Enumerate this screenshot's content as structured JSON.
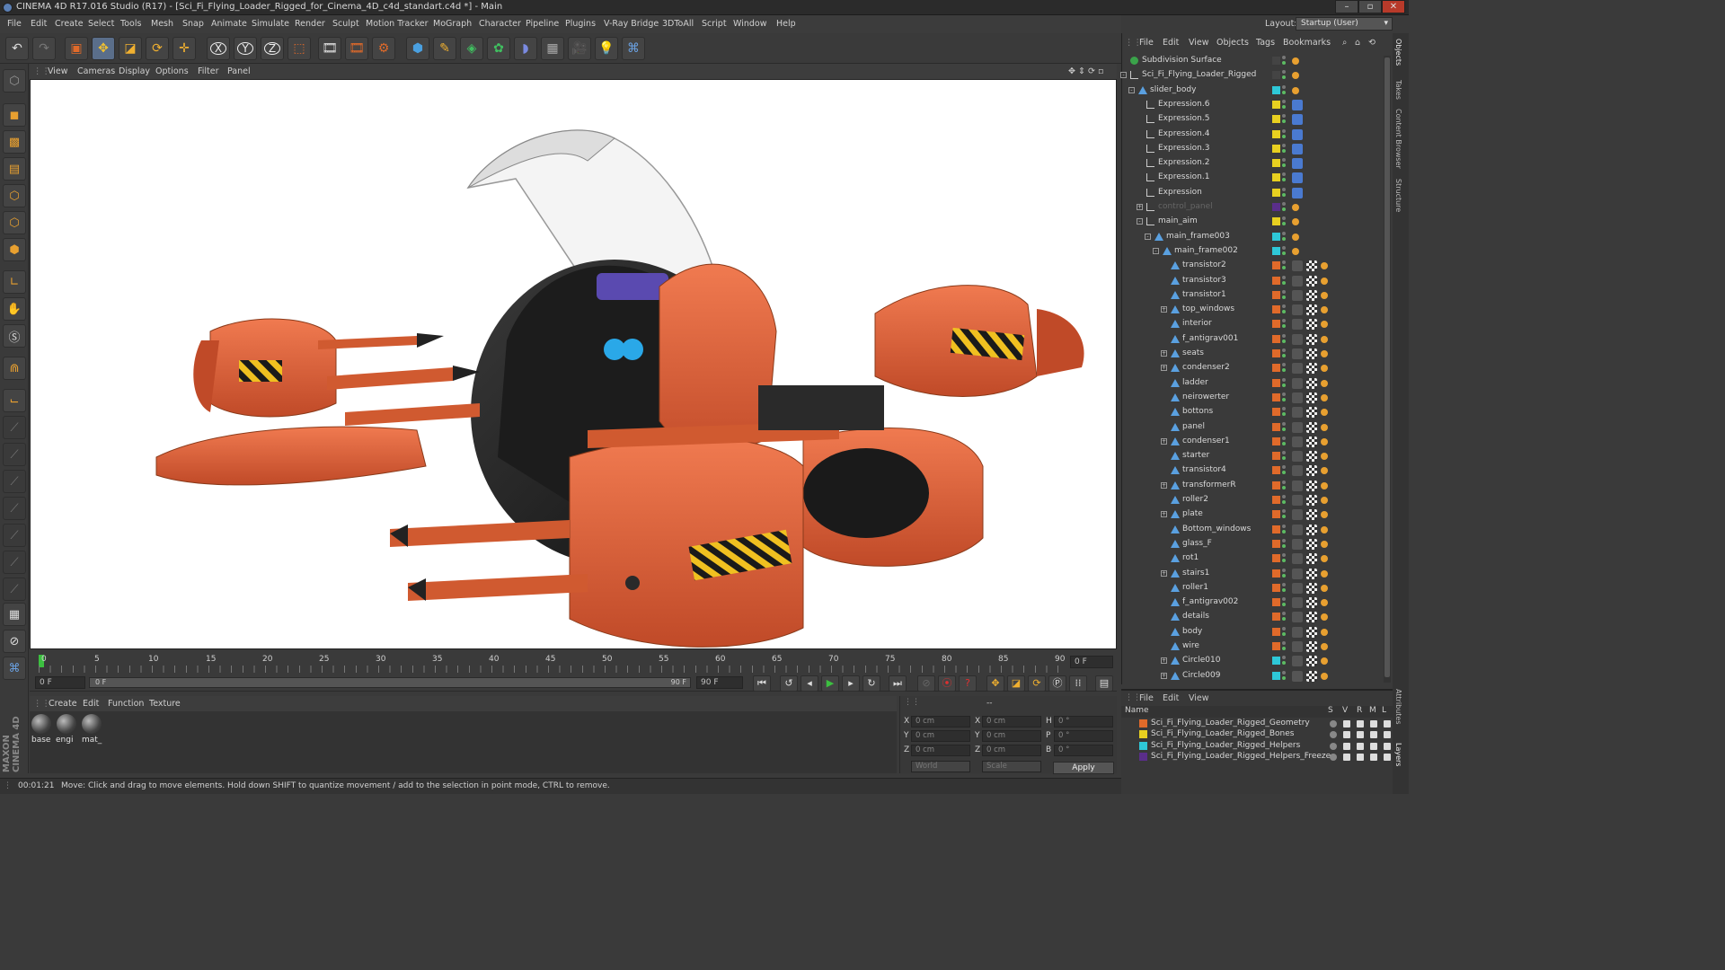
{
  "window": {
    "title": "CINEMA 4D R17.016 Studio (R17) - [Sci_Fi_Flying_Loader_Rigged_for_Cinema_4D_c4d_standart.c4d *] - Main"
  },
  "menu": [
    "File",
    "Edit",
    "Create",
    "Select",
    "Tools",
    "Mesh",
    "Snap",
    "Animate",
    "Simulate",
    "Render",
    "Sculpt",
    "Motion Tracker",
    "MoGraph",
    "Character",
    "Pipeline",
    "Plugins",
    "V-Ray Bridge",
    "3DToAll",
    "Script",
    "Window",
    "Help"
  ],
  "layout": {
    "label": "Layout:",
    "value": "Startup (User)"
  },
  "toolbar_icons": [
    "undo-icon",
    "redo-icon",
    "live-selection-icon",
    "move-icon",
    "scale-icon",
    "rotate-icon",
    "move-plus-icon",
    "x-axis-icon",
    "y-axis-icon",
    "z-axis-icon",
    "world-coordinates-icon",
    "render-view-icon",
    "render-picture-viewer-icon",
    "render-settings-icon",
    "cube-icon",
    "pen-icon",
    "subdivision-icon",
    "array-icon",
    "deformer-icon",
    "floor-icon",
    "camera-icon",
    "light-icon",
    "python-icon"
  ],
  "viewport_menu": [
    "View",
    "Cameras",
    "Display",
    "Options",
    "Filter",
    "Panel"
  ],
  "timeline": {
    "ticks": [
      "0",
      "5",
      "10",
      "15",
      "20",
      "25",
      "30",
      "35",
      "40",
      "45",
      "50",
      "55",
      "60",
      "65",
      "70",
      "75",
      "80",
      "85",
      "90"
    ],
    "current_frame": "0 F",
    "start_field": "0 F",
    "range_start": "0 F",
    "range_end": "90 F",
    "end_field": "90 F"
  },
  "material_menu": [
    "Create",
    "Edit",
    "Function",
    "Texture"
  ],
  "materials": [
    {
      "label": "base"
    },
    {
      "label": "engi"
    },
    {
      "label": "mat_"
    }
  ],
  "coords": {
    "header": "--",
    "rows": [
      {
        "a": "X",
        "av": "0 cm",
        "b": "X",
        "bv": "0 cm",
        "c": "H",
        "cv": "0 °"
      },
      {
        "a": "Y",
        "av": "0 cm",
        "b": "Y",
        "bv": "0 cm",
        "c": "P",
        "cv": "0 °"
      },
      {
        "a": "Z",
        "av": "0 cm",
        "b": "Z",
        "bv": "0 cm",
        "c": "B",
        "cv": "0 °"
      }
    ],
    "mode1": "World",
    "mode2": "Scale",
    "apply": "Apply"
  },
  "status": {
    "time": "00:01:21",
    "message": "Move: Click and drag to move elements. Hold down SHIFT to quantize movement / add to the selection in point mode, CTRL to remove."
  },
  "object_menu": [
    "File",
    "Edit",
    "View",
    "Objects",
    "Tags",
    "Bookmarks"
  ],
  "objects": [
    {
      "name": "Subdivision Surface",
      "indent": 0,
      "color": "#444444",
      "expand": ""
    },
    {
      "name": "Sci_Fi_Flying_Loader_Rigged",
      "indent": 0,
      "color": "#444444",
      "expand": "-"
    },
    {
      "name": "slider_body",
      "indent": 1,
      "color": "#2ec8d8",
      "expand": "-"
    },
    {
      "name": "Expression.6",
      "indent": 2,
      "color": "#e8d020",
      "expand": ""
    },
    {
      "name": "Expression.5",
      "indent": 2,
      "color": "#e8d020",
      "expand": ""
    },
    {
      "name": "Expression.4",
      "indent": 2,
      "color": "#e8d020",
      "expand": ""
    },
    {
      "name": "Expression.3",
      "indent": 2,
      "color": "#e8d020",
      "expand": ""
    },
    {
      "name": "Expression.2",
      "indent": 2,
      "color": "#e8d020",
      "expand": ""
    },
    {
      "name": "Expression.1",
      "indent": 2,
      "color": "#e8d020",
      "expand": ""
    },
    {
      "name": "Expression",
      "indent": 2,
      "color": "#e8d020",
      "expand": ""
    },
    {
      "name": "control_panel",
      "indent": 2,
      "color": "#5a2e8a",
      "expand": "+"
    },
    {
      "name": "main_aim",
      "indent": 2,
      "color": "#e8d020",
      "expand": "-"
    },
    {
      "name": "main_frame003",
      "indent": 3,
      "color": "#2ec8d8",
      "expand": "-"
    },
    {
      "name": "main_frame002",
      "indent": 4,
      "color": "#2ec8d8",
      "expand": "-"
    },
    {
      "name": "transistor2",
      "indent": 5,
      "color": "#e06a2a",
      "expand": ""
    },
    {
      "name": "transistor3",
      "indent": 5,
      "color": "#e06a2a",
      "expand": ""
    },
    {
      "name": "transistor1",
      "indent": 5,
      "color": "#e06a2a",
      "expand": ""
    },
    {
      "name": "top_windows",
      "indent": 5,
      "color": "#e06a2a",
      "expand": "+"
    },
    {
      "name": "interior",
      "indent": 5,
      "color": "#e06a2a",
      "expand": ""
    },
    {
      "name": "f_antigrav001",
      "indent": 5,
      "color": "#e06a2a",
      "expand": ""
    },
    {
      "name": "seats",
      "indent": 5,
      "color": "#e06a2a",
      "expand": "+"
    },
    {
      "name": "condenser2",
      "indent": 5,
      "color": "#e06a2a",
      "expand": "+"
    },
    {
      "name": "ladder",
      "indent": 5,
      "color": "#e06a2a",
      "expand": ""
    },
    {
      "name": "neirowerter",
      "indent": 5,
      "color": "#e06a2a",
      "expand": ""
    },
    {
      "name": "bottons",
      "indent": 5,
      "color": "#e06a2a",
      "expand": ""
    },
    {
      "name": "panel",
      "indent": 5,
      "color": "#e06a2a",
      "expand": ""
    },
    {
      "name": "condenser1",
      "indent": 5,
      "color": "#e06a2a",
      "expand": "+"
    },
    {
      "name": "starter",
      "indent": 5,
      "color": "#e06a2a",
      "expand": ""
    },
    {
      "name": "transistor4",
      "indent": 5,
      "color": "#e06a2a",
      "expand": ""
    },
    {
      "name": "transformerR",
      "indent": 5,
      "color": "#e06a2a",
      "expand": "+"
    },
    {
      "name": "roller2",
      "indent": 5,
      "color": "#e06a2a",
      "expand": ""
    },
    {
      "name": "plate",
      "indent": 5,
      "color": "#e06a2a",
      "expand": "+"
    },
    {
      "name": "Bottom_windows",
      "indent": 5,
      "color": "#e06a2a",
      "expand": ""
    },
    {
      "name": "glass_F",
      "indent": 5,
      "color": "#e06a2a",
      "expand": ""
    },
    {
      "name": "rot1",
      "indent": 5,
      "color": "#e06a2a",
      "expand": ""
    },
    {
      "name": "stairs1",
      "indent": 5,
      "color": "#e06a2a",
      "expand": "+"
    },
    {
      "name": "roller1",
      "indent": 5,
      "color": "#e06a2a",
      "expand": ""
    },
    {
      "name": "f_antigrav002",
      "indent": 5,
      "color": "#e06a2a",
      "expand": ""
    },
    {
      "name": "details",
      "indent": 5,
      "color": "#e06a2a",
      "expand": ""
    },
    {
      "name": "body",
      "indent": 5,
      "color": "#e06a2a",
      "expand": ""
    },
    {
      "name": "wire",
      "indent": 5,
      "color": "#e06a2a",
      "expand": ""
    },
    {
      "name": "Circle010",
      "indent": 5,
      "color": "#2ec8d8",
      "expand": "+"
    },
    {
      "name": "Circle009",
      "indent": 5,
      "color": "#2ec8d8",
      "expand": "+"
    }
  ],
  "layer_menu": [
    "File",
    "Edit",
    "View"
  ],
  "layer_header": {
    "name": "Name",
    "s": "S",
    "v": "V",
    "r": "R",
    "m": "M",
    "l": "L"
  },
  "layers": [
    {
      "name": "Sci_Fi_Flying_Loader_Rigged_Geometry",
      "color": "#e06a2a"
    },
    {
      "name": "Sci_Fi_Flying_Loader_Rigged_Bones",
      "color": "#e8d020"
    },
    {
      "name": "Sci_Fi_Flying_Loader_Rigged_Helpers",
      "color": "#2ec8d8"
    },
    {
      "name": "Sci_Fi_Flying_Loader_Rigged_Helpers_Freeze",
      "color": "#5a2e8a"
    }
  ],
  "side_tabs": [
    "Objects",
    "Takes",
    "Content Browser",
    "Structure",
    "Attributes",
    "Layers"
  ],
  "brand": "MAXON CINEMA 4D"
}
